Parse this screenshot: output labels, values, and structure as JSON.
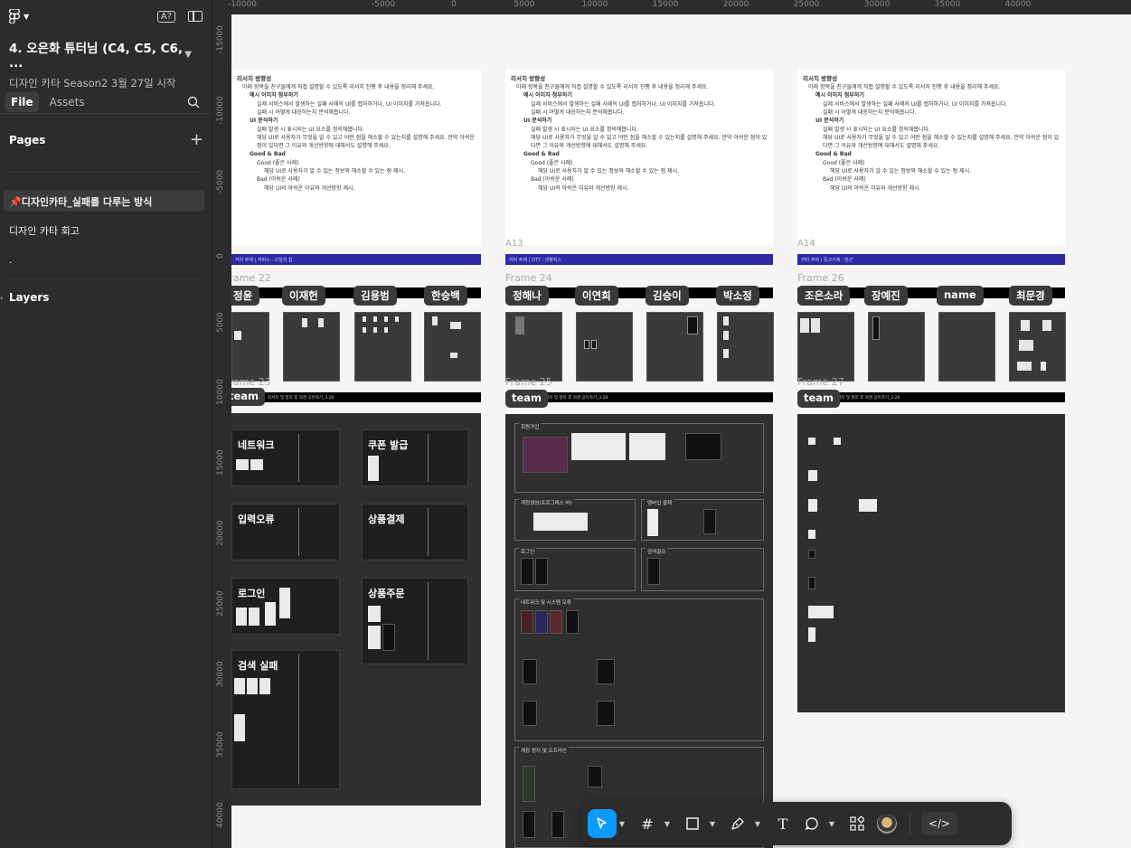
{
  "app": {
    "name": "Figma"
  },
  "sidebar": {
    "project_title": "4. 오은화 튜터님 (C4, C5, C6, ...",
    "project_subtitle": "디자인 카타 Season2 3월 27일 시작",
    "tabs": [
      "File",
      "Assets"
    ],
    "pages_label": "Pages",
    "pages": [
      "📌디자인카타_실패를 다루는 방식",
      "디자인 카타 회고",
      "."
    ],
    "layers_label": "Layers",
    "badge": "A?"
  },
  "ruler": {
    "x_ticks": [
      "-10000",
      "-5000",
      "0",
      "5000",
      "10000",
      "15000",
      "20000",
      "25000",
      "30000",
      "35000",
      "40000"
    ],
    "y_ticks": [
      "-15000",
      "-10000",
      "-5000",
      "0",
      "5000",
      "10000",
      "15000",
      "20000",
      "25000",
      "30000",
      "35000",
      "40000"
    ]
  },
  "doc": {
    "heading": "리서치 방향성",
    "intro": "아래 항목을 친구들에게 직접 설명할 수 있도록 리서치 진행 후 내용을 정리해 주세요.",
    "s1": "예시 이미지 첨부하기",
    "s1a": "실제 서비스에서 발생하는 실패 사례의 UI를 캡처하거나, UI 이미지를 가져옵니다.",
    "s1b": "실패 시 어떻게 대응하는지 분석해봅니다.",
    "s2": "UI 분석하기",
    "s2a": "실패 발생 시 표시되는 UI 요소를 정의해봅니다.",
    "s2b": "해당 UI로 사용자가 무엇을 알 수 있고 어떤 점을 해소할 수 있는지를 설명해 주세요. 만약 아쉬운 점이 있다면 그 이유와 개선방향에 대해서도 설명해 주세요.",
    "s3": "Good & Bad",
    "s3a": "Good (좋은 사례)",
    "s3a1": "해당 UI로 사용자가 알 수 있는 정보와 해소할 수 있는 점 제시.",
    "s3b": "Bad (아쉬운 사례)",
    "s3b1": "해당 UI의 아쉬운 이유와 개선방향 제시."
  },
  "columns": [
    {
      "bar": "카타 주제 | 커머스 : 오늘의 집",
      "a_label": "",
      "frame_top": "Frame 22",
      "frame_mid": "Frame 23",
      "names": [
        "정윤",
        "이재헌",
        "김용범",
        "한승백"
      ],
      "team": "team"
    },
    {
      "bar": "카타 주제 | OTT : 넷플릭스",
      "a_label": "A13",
      "frame_top": "Frame 24",
      "frame_mid": "Frame 25",
      "names": [
        "정해나",
        "이연희",
        "김승이",
        "박소정"
      ],
      "team": "team"
    },
    {
      "bar": "카타 주제 | 중고거래 : 당근",
      "a_label": "A14",
      "frame_top": "Frame 26",
      "frame_mid": "Frame 27",
      "names": [
        "조은소라",
        "장예진",
        "name",
        "최문경"
      ],
      "team": "team"
    }
  ],
  "team_bar_text": "리서치 및 정리 후 의견 공유하기_3.28",
  "col1_cards": [
    "네트워크",
    "쿠폰 발급",
    "입력오류",
    "상품결제",
    "로그인",
    "상품주문",
    "검색 실패"
  ],
  "col2_sections": [
    "회원가입",
    "계정생성(프로그레스 바)",
    "멤버십 결제",
    "로그인",
    "검색결과",
    "네트워크 및 시스템 오류",
    "계정 정지 및 오프라인"
  ],
  "toolbar": {
    "dev_label": "</>"
  },
  "colors": {
    "accent": "#0d99ff",
    "bar_blue": "#2d2aa6",
    "sidebar_bg": "#2c2c2c"
  }
}
